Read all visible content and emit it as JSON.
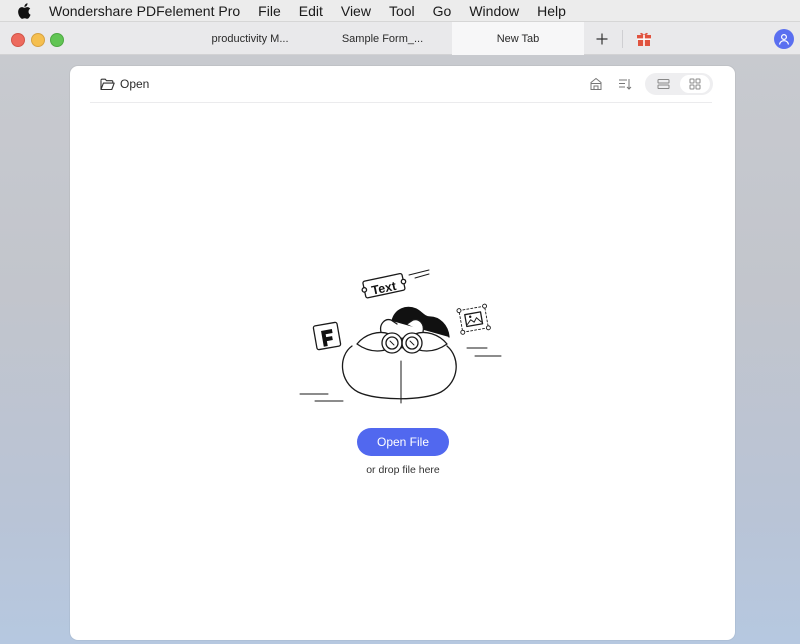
{
  "menubar": {
    "app_name": "Wondershare PDFelement Pro",
    "items": [
      "File",
      "Edit",
      "View",
      "Tool",
      "Go",
      "Window",
      "Help"
    ]
  },
  "tabs": [
    {
      "label": "productivity M..."
    },
    {
      "label": "Sample Form_..."
    },
    {
      "label": "New Tab",
      "active": true
    }
  ],
  "toolbar": {
    "open_label": "Open"
  },
  "illustration": {
    "text_tag": "Text"
  },
  "main": {
    "open_file_label": "Open File",
    "drop_hint": "or drop file here"
  },
  "colors": {
    "accent": "#5168ef",
    "gift": "#e0533f",
    "avatar": "#5a6ff0"
  }
}
